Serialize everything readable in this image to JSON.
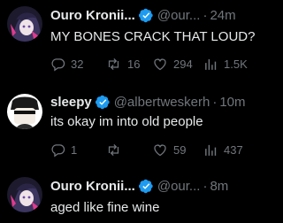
{
  "tweets": [
    {
      "name": "Ouro Kronii...",
      "handle": "@our...",
      "sep": "·",
      "time": "24m",
      "text": "MY BONES CRACK THAT LOUD?",
      "replies": "32",
      "retweets": "16",
      "likes": "294",
      "views": "1.5K"
    },
    {
      "name": "sleepy",
      "handle": "@albertweskerh",
      "sep": "·",
      "time": "10m",
      "text": "its okay im into old people",
      "replies": "1",
      "retweets": "",
      "likes": "59",
      "views": "437"
    },
    {
      "name": "Ouro Kronii...",
      "handle": "@our...",
      "sep": "·",
      "time": "8m",
      "text": "aged like fine wine"
    }
  ],
  "icons": {
    "verified": "verified-badge-icon",
    "reply": "reply-icon",
    "retweet": "retweet-icon",
    "like": "heart-icon",
    "views": "views-icon"
  },
  "colors": {
    "background": "#000000",
    "text": "#e7e9ea",
    "secondary": "#71767b",
    "verified": "#1d9bf0"
  }
}
